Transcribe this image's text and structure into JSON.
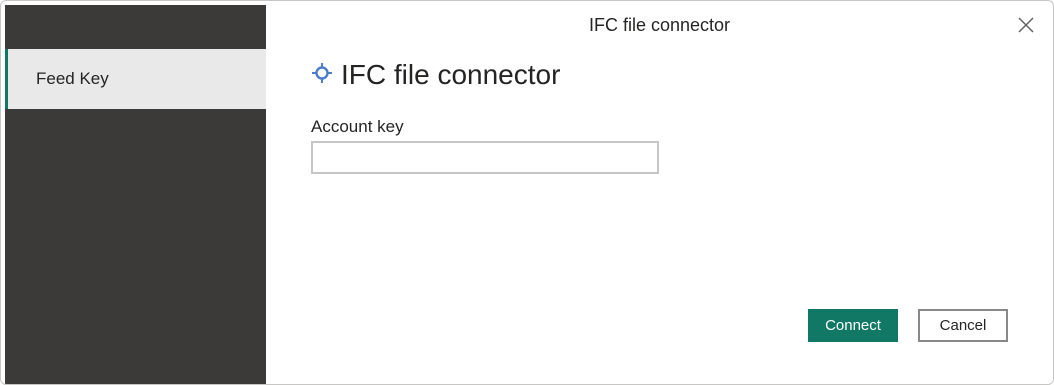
{
  "window": {
    "title": "IFC file connector",
    "close_icon": "close-icon"
  },
  "sidebar": {
    "items": [
      {
        "label": "Feed Key",
        "selected": true
      }
    ]
  },
  "main": {
    "heading": "IFC file connector",
    "heading_icon": "connector-icon",
    "account_key": {
      "label": "Account key",
      "value": "",
      "placeholder": ""
    }
  },
  "footer": {
    "connect_label": "Connect",
    "cancel_label": "Cancel"
  },
  "colors": {
    "accent": "#117865",
    "sidebar_bg": "#3b3a39",
    "selected_item_bg": "#e9e9e9",
    "icon_blue": "#4f7ec9"
  }
}
